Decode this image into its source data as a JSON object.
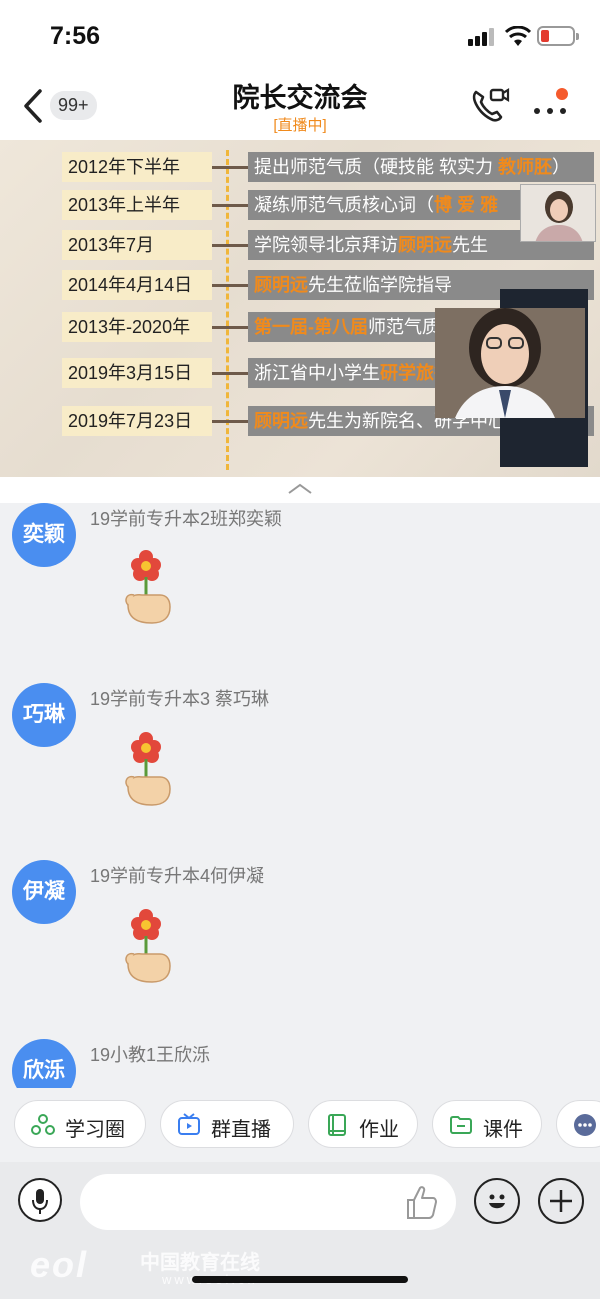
{
  "status_bar": {
    "time": "7:56"
  },
  "nav": {
    "back_count": "99+",
    "title": "院长交流会",
    "subtitle": "[直播中]"
  },
  "live": {
    "timeline": [
      {
        "date": "2012年下半年",
        "event": "提出师范气质（硬技能 软实力 教师胚）",
        "highlight": "教师胚"
      },
      {
        "date": "2013年上半年",
        "event": "凝练师范气质核心词（博 爱 雅",
        "highlight": "博 爱 雅"
      },
      {
        "date": "2013年7月",
        "event": "学院领导北京拜访顾明远先生",
        "highlight": "顾明远"
      },
      {
        "date": "2014年4月14日",
        "event": "顾明远先生莅临学院指导",
        "highlight": "顾明远"
      },
      {
        "date": "2013年-2020年",
        "event": "第一届-第八届师范气质",
        "highlight": "第一届-第八届"
      },
      {
        "date": "2019年3月15日",
        "event": "浙江省中小学生研学旅行",
        "highlight": "研学旅行"
      },
      {
        "date": "2019年7月23日",
        "event": "顾明远先生为新院名、研学中心",
        "highlight": "顾明远"
      }
    ]
  },
  "messages": [
    {
      "avatar": "奕颖",
      "sender": "19学前专升本2班郑奕颖"
    },
    {
      "avatar": "巧琳",
      "sender": "19学前专升本3 蔡巧琳"
    },
    {
      "avatar": "伊凝",
      "sender": "19学前专升本4何伊凝"
    },
    {
      "avatar": "欣泺",
      "sender": "19小教1王欣泺"
    }
  ],
  "tools": [
    {
      "label": "学习圈",
      "icon": "study-circle-icon",
      "color": "#3aa757"
    },
    {
      "label": "群直播",
      "icon": "live-tv-icon",
      "color": "#3a7ef0"
    },
    {
      "label": "作业",
      "icon": "homework-book-icon",
      "color": "#3aa757"
    },
    {
      "label": "课件",
      "icon": "folder-icon",
      "color": "#3aa757"
    }
  ],
  "watermark": {
    "logo": "eol",
    "cn": "中国教育在线",
    "url": "www.eol.cn"
  },
  "colors": {
    "accent_orange": "#f08a1c",
    "avatar_blue": "#4a8ef0",
    "badge_red": "#f55a2c"
  }
}
